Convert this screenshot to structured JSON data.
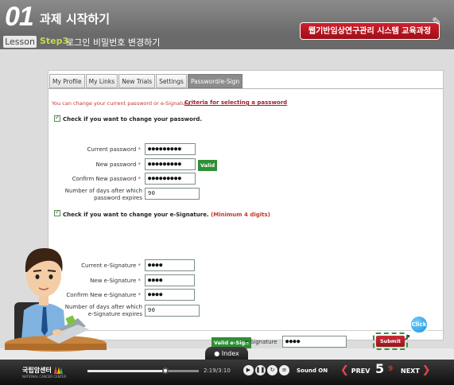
{
  "header": {
    "chapter_number": "01",
    "chapter_title": "과제 시작하기",
    "lesson_tag": "Lesson",
    "step_label": "Step3.",
    "step_title": "로그인 비밀번호 변경하기",
    "course_title": "웹기반임상연구관리 시스템 교육과정"
  },
  "tabs": [
    {
      "label": "My Profile",
      "active": false
    },
    {
      "label": "My Links",
      "active": false
    },
    {
      "label": "New Trials",
      "active": false
    },
    {
      "label": "Settings",
      "active": false
    },
    {
      "label": "Password/e-Sign",
      "active": true
    }
  ],
  "form": {
    "intro": "You can change your current password or e-Signature.",
    "criteria_link": "Criteria for selecting a password",
    "password_section": {
      "check_label": "Check if you want to change your password.",
      "current_label": "Current password",
      "current_value": "●●●●●●●●●",
      "new_label": "New password",
      "new_value": "●●●●●●●●●",
      "valid_badge": "Valid",
      "confirm_label": "Confirm New password",
      "confirm_value": "●●●●●●●●●",
      "days_label": "Number of days after which password expires",
      "days_value": "90"
    },
    "esig_section": {
      "check_label": "Check if you want to change your e-Signature.",
      "hint": "(Minimum 4 digits)",
      "current_label": "Current e-Signature",
      "current_value": "●●●●",
      "new_label": "New e-Signature",
      "new_value": "●●●●",
      "confirm_label": "Confirm New e-Signature",
      "confirm_value": "●●●●",
      "days_label": "Number of days after which e-Signature expires",
      "days_value": "90"
    },
    "verify": {
      "badge": "Valid e-Sign",
      "label": "e-Signature",
      "value": "●●●●"
    },
    "submit_label": "Submit",
    "click_bubble": "Click"
  },
  "required_mark": "*",
  "index_label": "Index",
  "footer": {
    "logo_text": "국립암센터",
    "logo_sub": "NATIONAL CANCER CENTER",
    "time": "2:19/3:10",
    "progress": 0.7,
    "sound_label": "Sound ON",
    "prev_label": "PREV",
    "page_current": "5",
    "page_total": "9",
    "next_label": "NEXT"
  },
  "colors": {
    "accent_red": "#c0392b",
    "valid_green": "#2f8f36",
    "course_red": "#d01f2c"
  }
}
